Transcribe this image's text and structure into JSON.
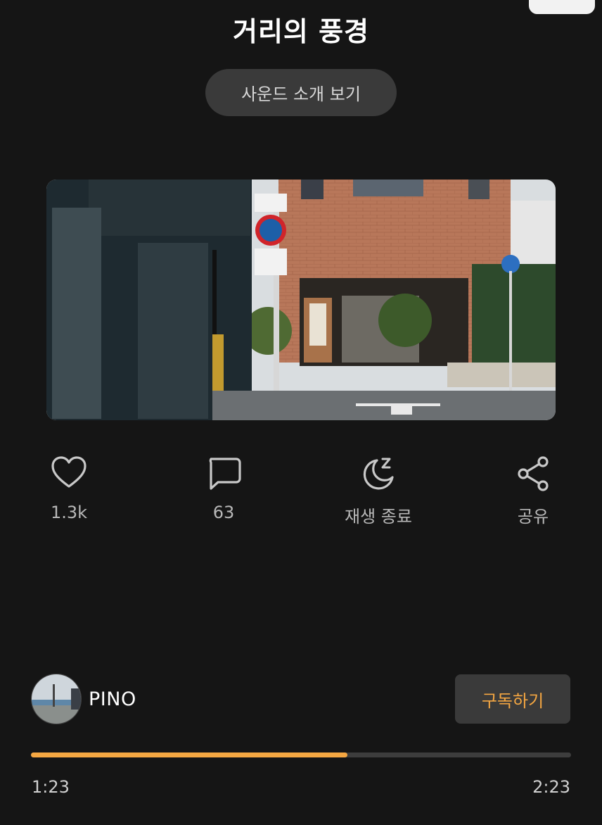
{
  "header": {
    "title": "거리의 풍경",
    "intro_button_label": "사운드 소개 보기"
  },
  "actions": [
    {
      "icon": "heart-icon",
      "label": "1.3k"
    },
    {
      "icon": "comment-icon",
      "label": "63"
    },
    {
      "icon": "sleep-timer-icon",
      "label": "재생 종료"
    },
    {
      "icon": "share-icon",
      "label": "공유"
    }
  ],
  "author": {
    "name": "PINO",
    "subscribe_label": "구독하기"
  },
  "player": {
    "progress": 0.586,
    "current_time": "1:23",
    "total_time": "2:23"
  },
  "colors": {
    "accent": "#f5a742",
    "background": "#151515",
    "button_bg": "#3a3a3a"
  }
}
